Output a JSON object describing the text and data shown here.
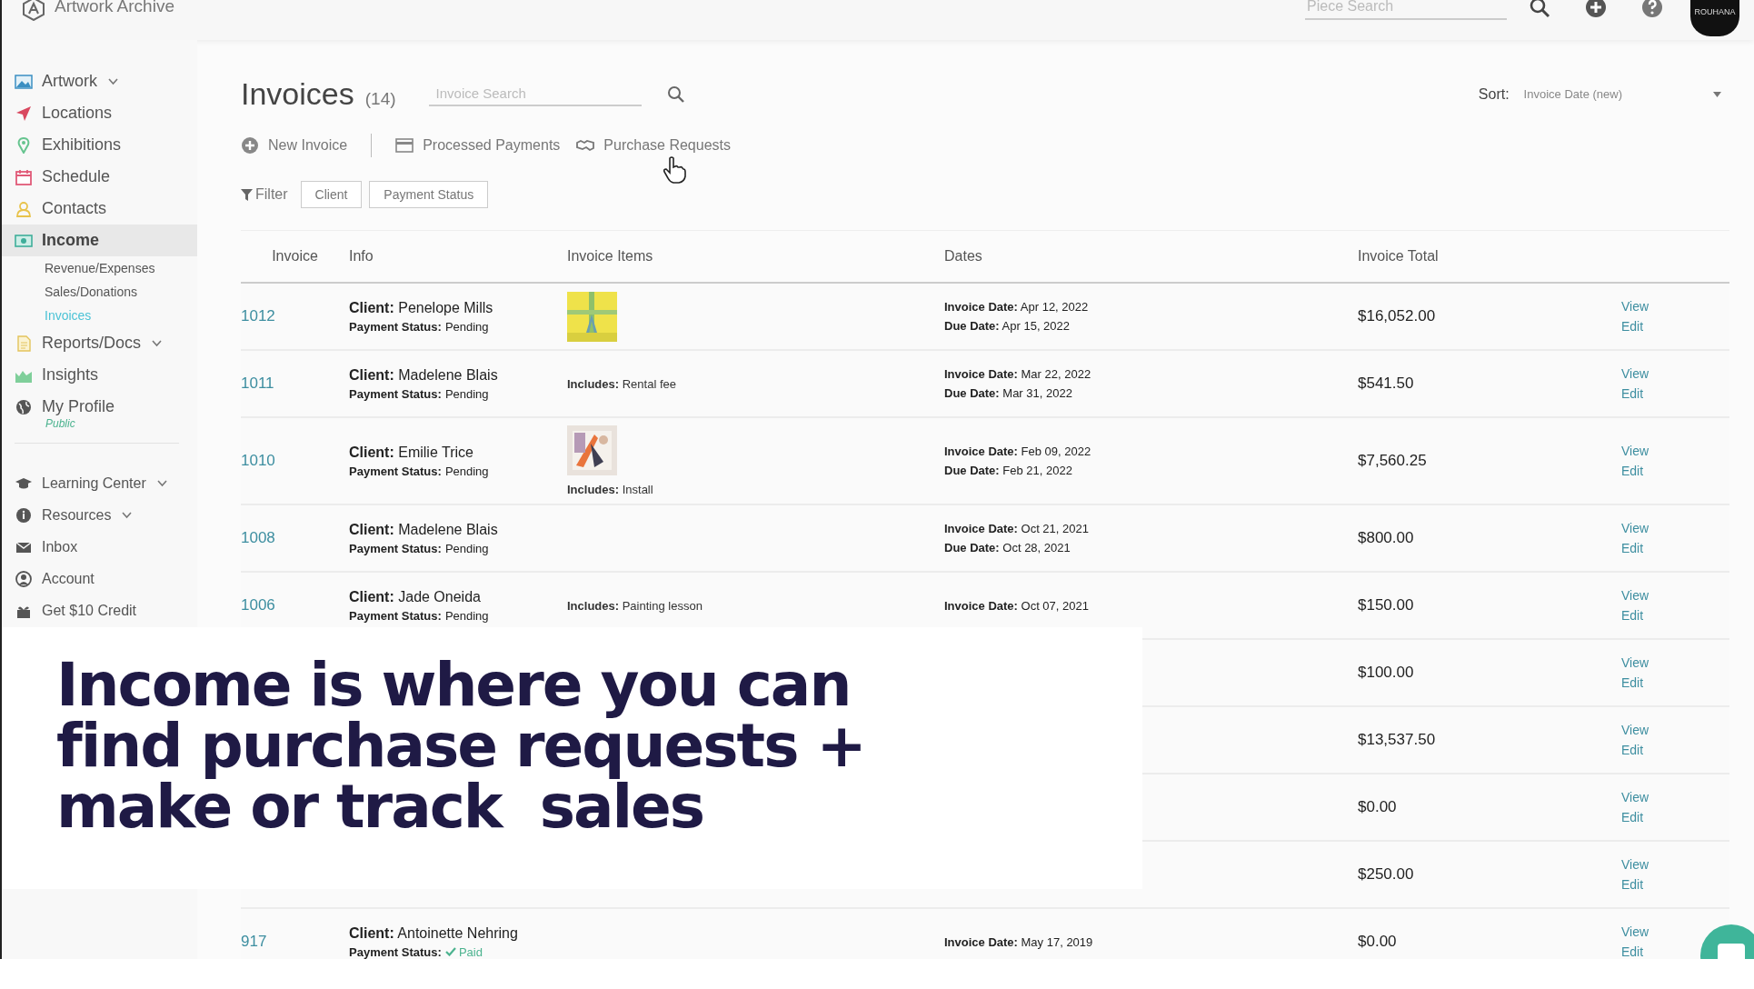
{
  "top_bar": {
    "app_name": "Artwork Archive",
    "search": {
      "placeholder": "Piece Search"
    },
    "avatar": {
      "text": "ROUHANA"
    }
  },
  "sidebar": {
    "groups": [
      {
        "items": [
          {
            "label": "Artwork",
            "selected": false,
            "expandable": true
          },
          {
            "label": "Locations",
            "selected": false,
            "expandable": false
          },
          {
            "label": "Exhibitions",
            "selected": false,
            "expandable": false
          },
          {
            "label": "Schedule",
            "selected": false,
            "expandable": false
          },
          {
            "label": "Contacts",
            "selected": false,
            "expandable": false
          },
          {
            "label": "Income",
            "selected": true,
            "expandable": false,
            "children": [
              {
                "label": "Revenue/Expenses",
                "selected": false
              },
              {
                "label": "Sales/Donations",
                "selected": false
              },
              {
                "label": "Invoices",
                "selected": true
              }
            ]
          },
          {
            "label": "Reports/Docs",
            "selected": false,
            "expandable": true
          },
          {
            "label": "Insights",
            "selected": false,
            "expandable": false
          },
          {
            "label": "My Profile",
            "selected": false,
            "expandable": false,
            "sublabel": "Public"
          }
        ]
      },
      {
        "items": [
          {
            "label": "Learning Center",
            "selected": false,
            "expandable": true
          },
          {
            "label": "Resources",
            "selected": false,
            "expandable": true
          },
          {
            "label": "Inbox",
            "selected": false,
            "expandable": false
          },
          {
            "label": "Account",
            "selected": false,
            "expandable": false
          },
          {
            "label": "Get $10 Credit",
            "selected": false,
            "expandable": false
          }
        ]
      }
    ]
  },
  "main": {
    "title": "Invoices",
    "count": "(14)",
    "search": {
      "placeholder": "Invoice Search"
    },
    "sort": {
      "label": "Sort:",
      "value": "Invoice Date (new)"
    },
    "actions": [
      "New Invoice",
      "Processed Payments",
      "Purchase Requests"
    ],
    "filter": {
      "label": "Filter",
      "buttons": [
        "Client",
        "Payment Status"
      ]
    },
    "table": {
      "columns": [
        "Invoice",
        "Info",
        "Invoice Items",
        "Dates",
        "Invoice Total"
      ],
      "rows": [
        {
          "number": "1012",
          "client": "**Client:** Penelope Mills",
          "status": "**Payment Status:**",
          "status_value": "Pending",
          "paid": false,
          "thumbnail": {
            "kind": "picture"
          },
          "dates": [
            "**Invoice Date:** Apr 12, 2022",
            "**Due Date:** Apr 15, 2022"
          ],
          "total": "$16,052.00",
          "links": [
            "View",
            "Edit"
          ]
        },
        {
          "number": "1011",
          "client": "**Client:** Madelene Blais",
          "status": "**Payment Status:**",
          "status_value": "Pending",
          "paid": false,
          "includes": "**Includes:** Rental fee",
          "dates": [
            "**Invoice Date:** Mar 22, 2022",
            "**Due Date:** Mar 31, 2022"
          ],
          "total": "$541.50",
          "links": [
            "View",
            "Edit"
          ]
        },
        {
          "number": "1010",
          "client": "**Client:** Emilie Trice",
          "status": "**Payment Status:**",
          "status_value": "Pending",
          "paid": false,
          "thumbnail": {
            "kind": "picture"
          },
          "includes": "**Includes:** Install",
          "dates": [
            "**Invoice Date:** Feb 09, 2022",
            "**Due Date:** Feb 21, 2022"
          ],
          "total": "$7,560.25",
          "links": [
            "View",
            "Edit"
          ]
        },
        {
          "number": "1008",
          "client": "**Client:** Madelene Blais",
          "status": "**Payment Status:**",
          "status_value": "Pending",
          "paid": false,
          "dates": [
            "**Invoice Date:** Oct 21, 2021",
            "**Due Date:** Oct 28, 2021"
          ],
          "total": "$800.00",
          "links": [
            "View",
            "Edit"
          ]
        },
        {
          "number": "1006",
          "client": "**Client:** Jade Oneida",
          "status": "**Payment Status:**",
          "status_value": "Pending",
          "paid": false,
          "includes": "**Includes:** Painting lesson",
          "dates": [
            "**Invoice Date:** Oct 07, 2021"
          ],
          "total": "$150.00",
          "links": [
            "View",
            "Edit"
          ]
        },
        {
          "total": "$100.00",
          "links": [
            "View",
            "Edit"
          ]
        },
        {
          "total": "$13,537.50",
          "links": [
            "View",
            "Edit"
          ]
        },
        {
          "total": "$0.00",
          "links": [
            "View",
            "Edit"
          ]
        },
        {
          "total": "$250.00",
          "links": [
            "View",
            "Edit"
          ]
        },
        {
          "number": "917",
          "client": "**Client:** Antoinette Nehring",
          "status": "**Payment Status:**",
          "status_value": "Paid",
          "paid": true,
          "dates": [
            "**Invoice Date:** May 17, 2019"
          ],
          "total": "$0.00",
          "links": [
            "View",
            "Edit"
          ]
        }
      ]
    }
  },
  "caption": {
    "lines": [
      "Income is where you can",
      "find purchase requests +",
      "make or track  sales"
    ]
  }
}
